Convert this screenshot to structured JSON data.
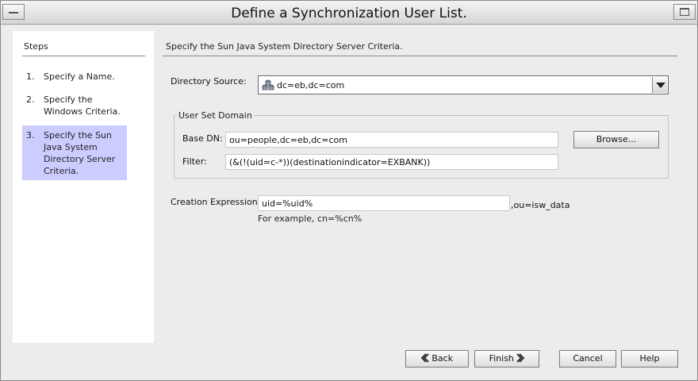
{
  "window": {
    "title": "Define a Synchronization User List."
  },
  "steps": {
    "title": "Steps",
    "items": [
      {
        "num": "1.",
        "label": "Specify a Name.",
        "active": false
      },
      {
        "num": "2.",
        "label": "Specify the Windows Criteria.",
        "active": false
      },
      {
        "num": "3.",
        "label": "Specify the Sun Java System Directory Server Criteria.",
        "active": true
      }
    ]
  },
  "content": {
    "header": "Specify the Sun Java System Directory Server Criteria.",
    "directory_source": {
      "label": "Directory Source:",
      "value": "dc=eb,dc=com",
      "icon": "database-icon"
    },
    "user_set_domain": {
      "title": "User Set Domain",
      "base_dn": {
        "label": "Base DN:",
        "value": "ou=people,dc=eb,dc=com"
      },
      "filter": {
        "label": "Filter:",
        "value": "(&(!(uid=c-*))(destinationindicator=EXBANK))"
      },
      "browse_label": "Browse..."
    },
    "creation_expression": {
      "label": "Creation Expression:",
      "value": "uid=%uid%",
      "suffix": ",ou=isw_data",
      "hint": "For example, cn=%cn%"
    }
  },
  "buttons": {
    "back": "Back",
    "finish": "Finish",
    "cancel": "Cancel",
    "help": "Help"
  },
  "colors": {
    "active_step": "#ccccff",
    "background": "#ececec",
    "panel": "#ffffff"
  }
}
